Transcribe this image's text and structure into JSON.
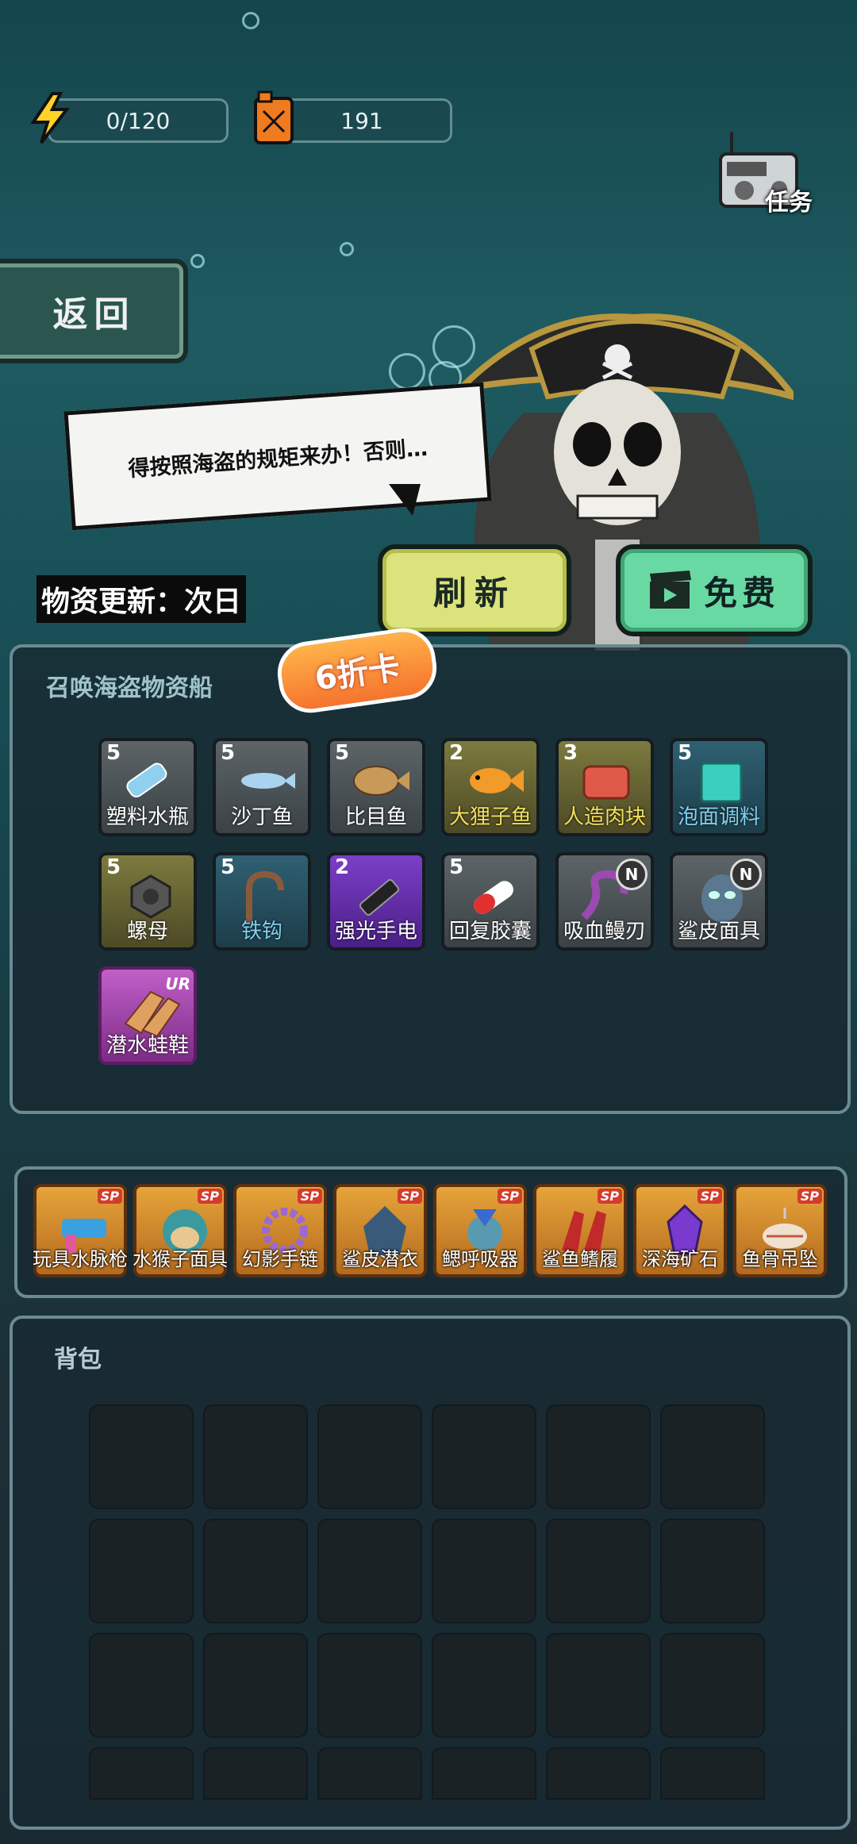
{
  "resources": {
    "energy": "0/120",
    "fuel": "191"
  },
  "task_label": "任务",
  "back_label": "返回",
  "speech": "得按照海盗的规矩来办！否则…",
  "supply_update": "物资更新：次日",
  "buttons": {
    "refresh": "刷新",
    "free": "免费"
  },
  "summon_panel": {
    "title": "召唤海盗物资船",
    "discount": "6折卡",
    "items": [
      {
        "name": "塑料水瓶",
        "count": "5",
        "rarity": "gray",
        "icon": "bottle-icon"
      },
      {
        "name": "沙丁鱼",
        "count": "5",
        "rarity": "gray",
        "icon": "sardine-icon"
      },
      {
        "name": "比目鱼",
        "count": "5",
        "rarity": "gray",
        "icon": "flatfish-icon"
      },
      {
        "name": "大狸子鱼",
        "count": "2",
        "rarity": "olive",
        "icon": "fish-icon"
      },
      {
        "name": "人造肉块",
        "count": "3",
        "rarity": "olive",
        "icon": "meat-icon"
      },
      {
        "name": "泡面调料",
        "count": "5",
        "rarity": "blue",
        "icon": "seasoning-icon"
      },
      {
        "name": "螺母",
        "count": "5",
        "rarity": "olive",
        "icon": "nut-icon"
      },
      {
        "name": "铁钩",
        "count": "5",
        "rarity": "blue",
        "icon": "hook-icon"
      },
      {
        "name": "强光手电",
        "count": "2",
        "rarity": "purple",
        "icon": "flashlight-icon"
      },
      {
        "name": "回复胶囊",
        "count": "5",
        "rarity": "gray",
        "icon": "capsule-icon"
      },
      {
        "name": "吸血鳗刃",
        "badge": "N",
        "rarity": "gray",
        "icon": "eel-blade-icon"
      },
      {
        "name": "鲨皮面具",
        "badge": "N",
        "rarity": "gray",
        "icon": "shark-mask-icon"
      },
      {
        "name": "潜水蛙鞋",
        "badge": "UR",
        "rarity": "pink",
        "icon": "flippers-icon"
      }
    ]
  },
  "sp_items": [
    {
      "name": "玩具水脉枪",
      "tag": "SP"
    },
    {
      "name": "水猴子面具",
      "tag": "SP"
    },
    {
      "name": "幻影手链",
      "tag": "SP"
    },
    {
      "name": "鲨皮潜衣",
      "tag": "SP"
    },
    {
      "name": "鳃呼吸器",
      "tag": "SP"
    },
    {
      "name": "鲨鱼鳍履",
      "tag": "SP"
    },
    {
      "name": "深海矿石",
      "tag": "SP"
    },
    {
      "name": "鱼骨吊坠",
      "tag": "SP"
    }
  ],
  "backpack": {
    "title": "背包"
  }
}
